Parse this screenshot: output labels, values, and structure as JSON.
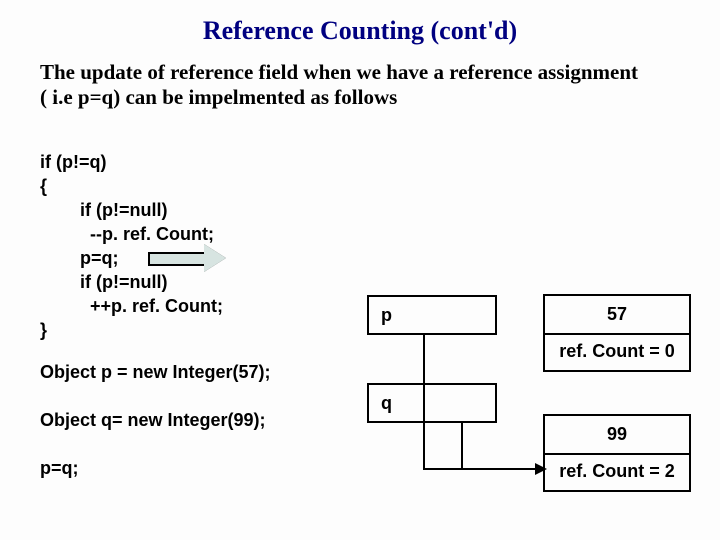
{
  "title": "Reference Counting (cont'd)",
  "subtitle": "The update of reference field when we have a reference assignment ( i.e p=q) can be impelmented as follows",
  "code": {
    "l1": "if (p!=q)",
    "l2": "{",
    "l3": "if (p!=null)",
    "l4": "  --p. ref. Count;",
    "l5": "p=q;",
    "l6": "if (p!=null)",
    "l7": "  ++p. ref. Count;",
    "l8": "}",
    "d1": "Object p = new Integer(57);",
    "d2": "Object q= new Integer(99);",
    "d3": "p=q;"
  },
  "diagram": {
    "p_label": "p",
    "q_label": "q",
    "box1_val": "57",
    "box1_rc": "ref. Count = 0",
    "box2_val": "99",
    "box2_rc": "ref. Count = 2"
  }
}
